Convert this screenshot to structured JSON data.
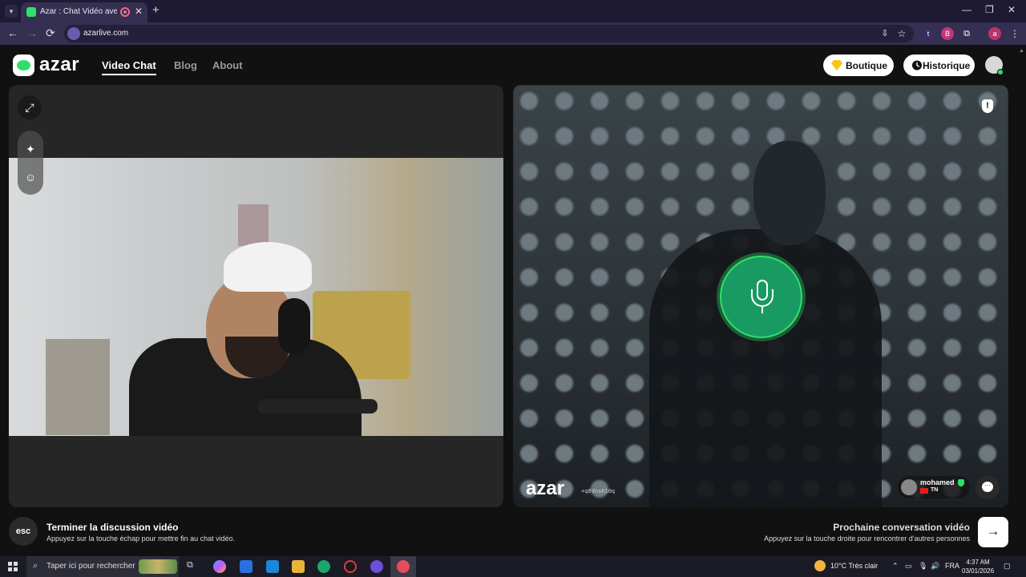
{
  "browser": {
    "tab_title": "Azar : Chat Vidéo avec de n",
    "tab_close": "✕",
    "new_tab": "+",
    "url": "azarlive.com",
    "window_controls": [
      "—",
      "❐",
      "✕"
    ],
    "nav": [
      "←",
      "→",
      "⟳"
    ],
    "ext_labels": [
      "t",
      "B",
      "a"
    ]
  },
  "site": {
    "logo": "azar",
    "nav": [
      {
        "label": "Video Chat",
        "active": true
      },
      {
        "label": "Blog",
        "active": false
      },
      {
        "label": "About",
        "active": false
      }
    ],
    "boutique": "Boutique",
    "historique": "Historique"
  },
  "peer": {
    "watermark_logo": "azar",
    "watermark_id": "+q8Vnsh10q",
    "name": "mohamed",
    "country": "TN"
  },
  "footer": {
    "esc_key": "esc",
    "end_title": "Terminer la discussion vidéo",
    "end_sub": "Appuyez sur la touche échap pour mettre fin au chat vidéo.",
    "next_title": "Prochaine conversation vidéo",
    "next_sub": "Appuyez sur la touche droite pour rencontrer d'autres personnes",
    "next_arrow": "→"
  },
  "taskbar": {
    "search_placeholder": "Taper ici pour rechercher",
    "weather": "10°C  Très clair",
    "language": "FRA",
    "time": "4:37 AM",
    "date": "03/01/2026"
  },
  "colors": {
    "accent": "#2ee06a",
    "mic": "#1a9a63",
    "tab_bar": "#1e1a33",
    "address_bar": "#352f52"
  }
}
